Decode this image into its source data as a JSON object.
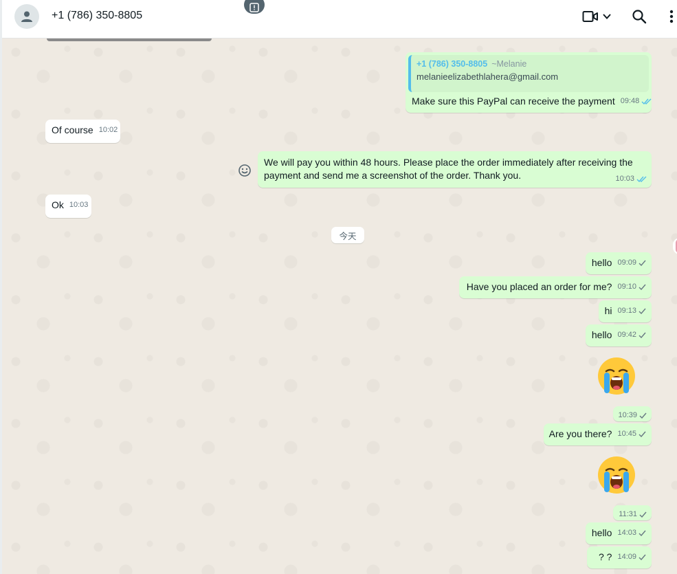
{
  "header": {
    "contact_name": "+1 (786) 350-8805",
    "icons": [
      "avatar-person-icon",
      "video-call-icon",
      "chevron-down-icon",
      "search-icon",
      "more-options-icon"
    ]
  },
  "colors": {
    "incoming_bubble": "#ffffff",
    "outgoing_bubble": "#d9fdd3",
    "chat_background": "#efeae2",
    "read_tick": "#53bdeb",
    "sent_tick": "#667781",
    "quote_accent": "#53bdeb"
  },
  "messages": [
    {
      "id": "m1",
      "dir": "out",
      "quote_phone": "+1 (786) 350-8805",
      "quote_name": "~Melanie",
      "quote_text": "melanieelizabethlahera@gmail.com",
      "text": "Make sure this PayPal can receive the payment",
      "time": "09:48",
      "status": "read"
    },
    {
      "id": "m2",
      "dir": "in",
      "text": "Of course",
      "time": "10:02"
    },
    {
      "id": "m3",
      "dir": "out",
      "text": "We will pay you within 48 hours. Please place the order immediately after receiving the payment and send me a screenshot of the order. Thank you.",
      "time": "10:03",
      "status": "read"
    },
    {
      "id": "m4",
      "dir": "in",
      "text": "Ok",
      "time": "10:03"
    },
    {
      "id": "m5",
      "dir": "out",
      "text": "hello",
      "time": "09:09",
      "status": "sent"
    },
    {
      "id": "m6",
      "dir": "out",
      "text": "Have you placed an order for me?",
      "time": "09:10",
      "status": "sent"
    },
    {
      "id": "m7",
      "dir": "out",
      "text": "hi",
      "time": "09:13",
      "status": "sent"
    },
    {
      "id": "m8",
      "dir": "out",
      "text": "hello",
      "time": "09:42",
      "status": "sent"
    },
    {
      "id": "m9",
      "dir": "out",
      "emoji": "loudly-crying-face",
      "time": "10:39",
      "status": "sent"
    },
    {
      "id": "m10",
      "dir": "out",
      "text": "Are you there?",
      "time": "10:45",
      "status": "sent"
    },
    {
      "id": "m11",
      "dir": "out",
      "emoji": "loudly-crying-face",
      "time": "11:31",
      "status": "sent"
    },
    {
      "id": "m12",
      "dir": "out",
      "text": "hello",
      "time": "14:03",
      "status": "sent"
    },
    {
      "id": "m13",
      "dir": "out",
      "text": "? ?",
      "time": "14:09",
      "status": "sent"
    }
  ],
  "day_separator": "今天"
}
